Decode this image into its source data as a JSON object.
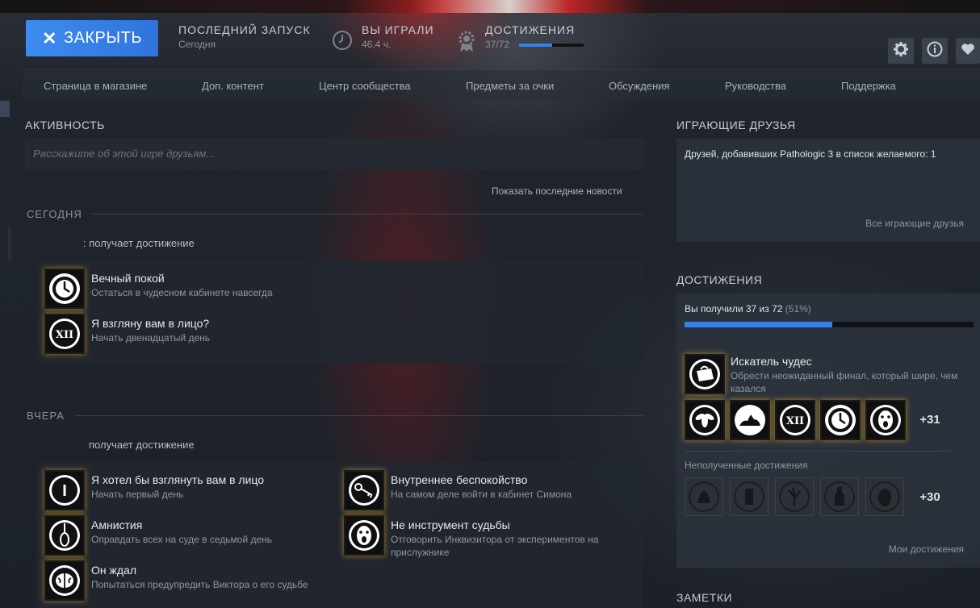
{
  "header": {
    "close_label": "ЗАКРЫТЬ",
    "last_launch_label": "ПОСЛЕДНИЙ ЗАПУСК",
    "last_launch_value": "Сегодня",
    "played_label": "ВЫ ИГРАЛИ",
    "played_value": "46,4 ч.",
    "achievements_label": "ДОСТИЖЕНИЯ",
    "achievements_value": "37/72",
    "achievements_progress": 0.51,
    "icons": [
      "settings-icon",
      "info-icon",
      "heart-icon"
    ]
  },
  "nav": {
    "items": [
      "Страница в магазине",
      "Доп. контент",
      "Центр сообщества",
      "Предметы за очки",
      "Обсуждения",
      "Руководства",
      "Поддержка"
    ]
  },
  "activity": {
    "title": "АКТИВНОСТЬ",
    "placeholder": "Расскажите об этой игре друзьям...",
    "news_link": "Показать последние новости",
    "today": {
      "header": "СЕГОДНЯ",
      "gets_text": ": получает достижение",
      "achievements": [
        {
          "name": "Вечный покой",
          "desc": "Остаться в чудесном кабинете навсегда",
          "icon": "clock-emblem-icon"
        },
        {
          "name": "Я взгляну вам в лицо?",
          "desc": "Начать двенадцатый день",
          "icon": "roman-xii-icon"
        }
      ]
    },
    "yesterday": {
      "header": "ВЧЕРА",
      "gets_text": "получает достижение",
      "achievements": [
        {
          "name": "Я хотел бы взглянуть вам в лицо",
          "desc": "Начать первый день",
          "icon": "roman-i-icon"
        },
        {
          "name": "Внутреннее беспокойство",
          "desc": "На самом деле войти в кабинет Симона",
          "icon": "key-icon"
        },
        {
          "name": "Амнистия",
          "desc": "Оправдать всех на суде в седьмой день",
          "icon": "noose-icon"
        },
        {
          "name": "Не инструмент судьбы",
          "desc": "Отговорить Инквизитора от экспериментов на прислужнике",
          "icon": "screaming-face-icon"
        },
        {
          "name": "Он ждал",
          "desc": "Попытаться предупредить Виктора о его судьбе",
          "icon": "brain-icon"
        }
      ]
    }
  },
  "friends": {
    "title": "ИГРАЮЩИЕ ДРУЗЬЯ",
    "wishlist_text": "Друзей, добавивших Pathologic 3 в список желаемого: 1",
    "all_link": "Все играющие друзья"
  },
  "achievements_panel": {
    "title": "ДОСТИЖЕНИЯ",
    "progress_text": "Вы получили 37 из 72",
    "progress_pct": "(51%)",
    "progress": 0.51,
    "featured": {
      "name": "Искатель чудес",
      "desc": "Обрести неожиданный финал, который шире, чем казался",
      "icon": "bag-icon"
    },
    "unlocked_icons": [
      "fly-icon",
      "bull-icon",
      "roman-xii-icon",
      "clock-emblem-icon",
      "screaming-face-icon"
    ],
    "unlocked_more": "+31",
    "locked_title": "Неполученные достижения",
    "locked_icons": [
      "bull-head-icon",
      "figure-icon",
      "tree-icon",
      "bottle-icon",
      "mask-icon"
    ],
    "locked_more": "+30",
    "my_link": "Мои достижения"
  },
  "notes": {
    "title": "ЗАМЕТКИ"
  }
}
